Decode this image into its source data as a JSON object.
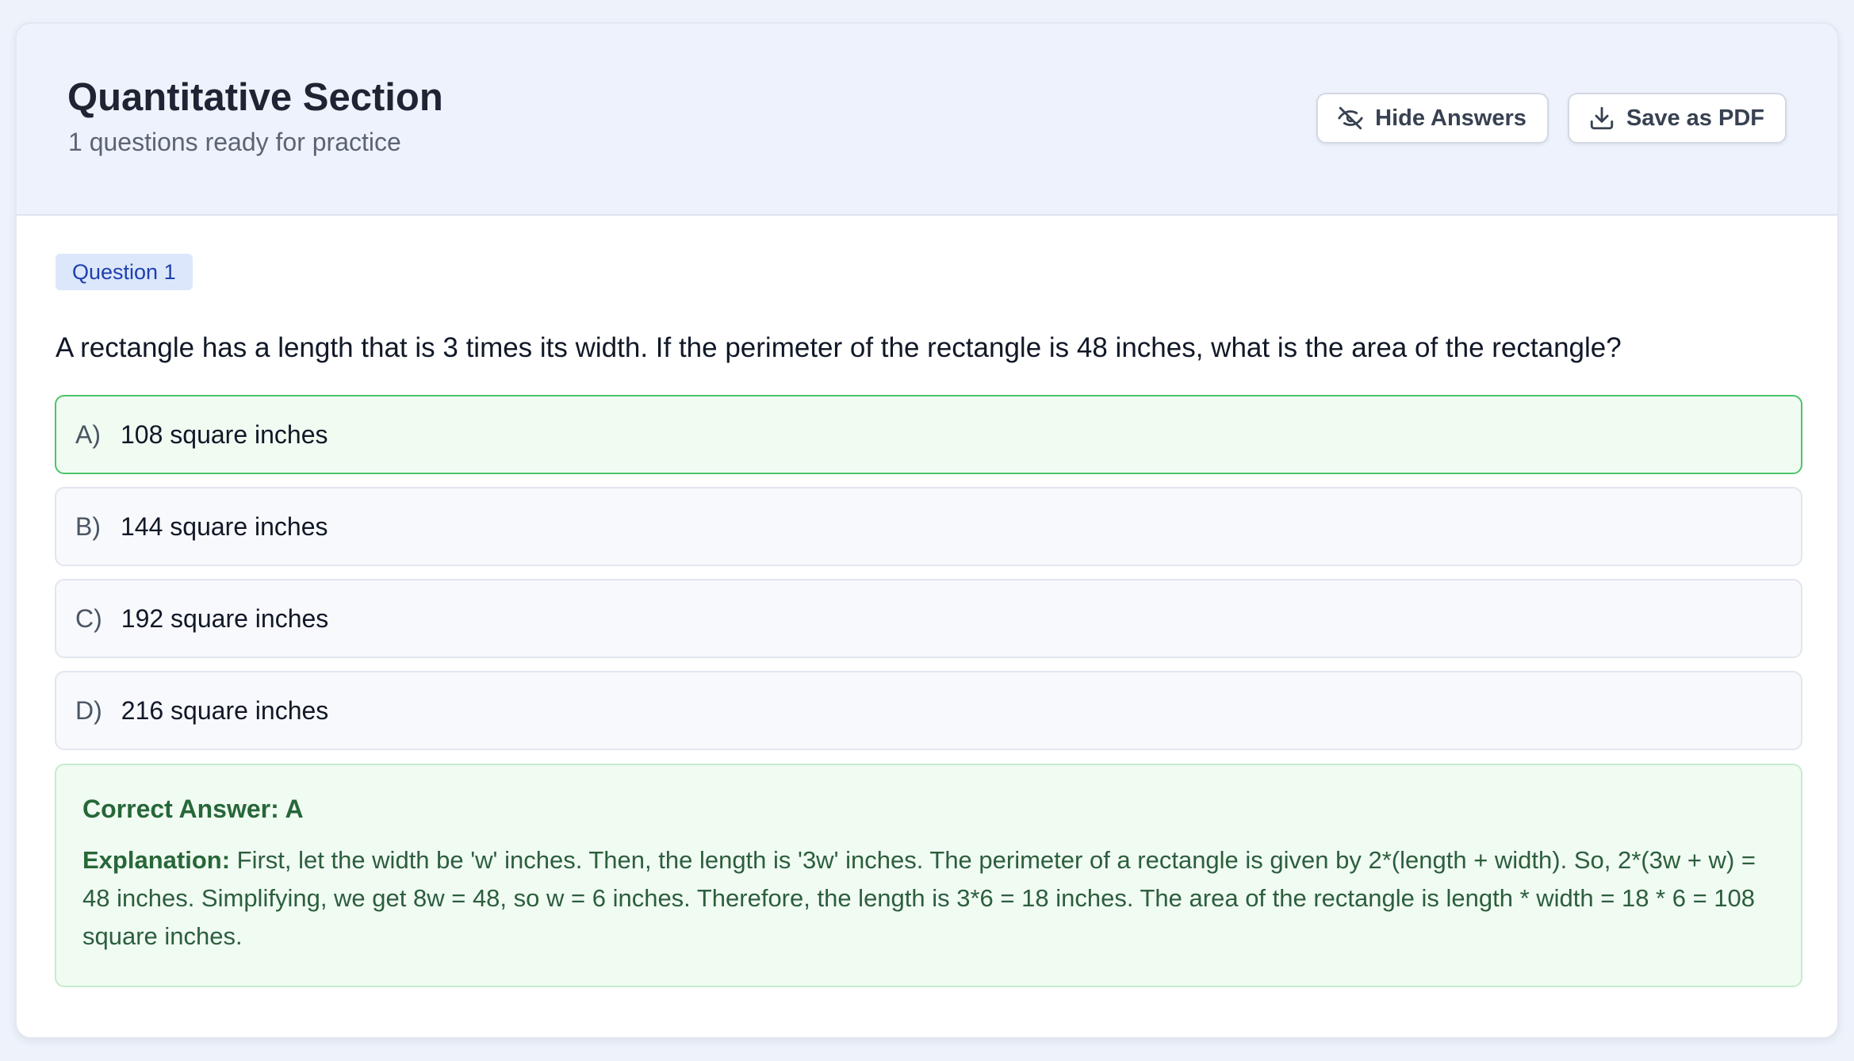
{
  "header": {
    "title": "Quantitative Section",
    "subtitle": "1 questions ready for practice",
    "hide_answers_label": "Hide Answers",
    "save_pdf_label": "Save as PDF",
    "hide_answers_icon": "eye-off-icon",
    "save_pdf_icon": "download-icon"
  },
  "question": {
    "badge": "Question 1",
    "text": "A rectangle has a length that is 3 times its width. If the perimeter of the rectangle is 48 inches, what is the area of the rectangle?",
    "options": [
      {
        "letter": "A)",
        "text": "108 square inches",
        "correct": true
      },
      {
        "letter": "B)",
        "text": "144 square inches",
        "correct": false
      },
      {
        "letter": "C)",
        "text": "192 square inches",
        "correct": false
      },
      {
        "letter": "D)",
        "text": "216 square inches",
        "correct": false
      }
    ],
    "correct_answer": "Correct Answer: A",
    "explanation_label": "Explanation:",
    "explanation_text": " First, let the width be 'w' inches. Then, the length is '3w' inches. The perimeter of a rectangle is given by 2*(length + width). So, 2*(3w + w) = 48 inches. Simplifying, we get 8w = 48, so w = 6 inches. Therefore, the length is 3*6 = 18 inches. The area of the rectangle is length * width = 18 * 6 = 108 square inches."
  },
  "colors": {
    "page_background": "#eef2fb",
    "header_background": "#eef2fc",
    "badge_background": "#dce7fb",
    "badge_text": "#1e40af",
    "correct_border": "#4cc46a",
    "correct_background": "#f0fbf2",
    "correct_text": "#276738"
  }
}
